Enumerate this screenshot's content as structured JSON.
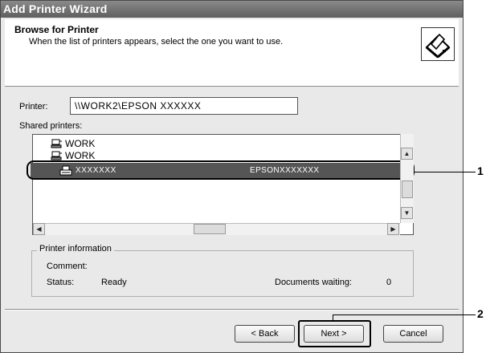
{
  "window": {
    "title": "Add Printer Wizard"
  },
  "header": {
    "title": "Browse for Printer",
    "subtitle": "When the list of printers appears, select the one you want to use."
  },
  "printer_field": {
    "label": "Printer:",
    "value": "\\\\WORK2\\EPSON XXXXXX"
  },
  "shared_printers": {
    "label": "Shared printers:",
    "items": [
      {
        "label": "WORK",
        "icon": "network-computer-icon"
      },
      {
        "label": "WORK",
        "icon": "network-computer-icon"
      },
      {
        "label": "XXXXXXX",
        "description": "EPSONXXXXXXX",
        "icon": "printer-icon",
        "selected": true
      }
    ]
  },
  "printer_information": {
    "legend": "Printer information",
    "comment_label": "Comment:",
    "status_label": "Status:",
    "status_value": "Ready",
    "documents_waiting_label": "Documents waiting:",
    "documents_waiting_value": "0"
  },
  "buttons": {
    "back": "< Back",
    "next": "Next >",
    "cancel": "Cancel"
  },
  "callouts": {
    "one": "1",
    "two": "2"
  }
}
